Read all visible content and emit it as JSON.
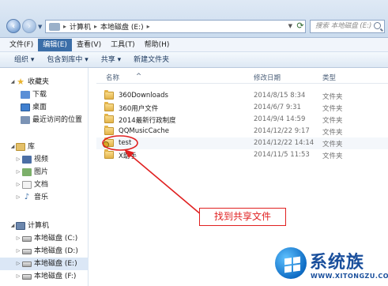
{
  "address_bar": {
    "segments": [
      "计算机",
      "本地磁盘 (E:)"
    ],
    "search_placeholder": "搜索 本地磁盘 (E:)"
  },
  "menu_bar": {
    "items": [
      {
        "label": "文件(F)",
        "active": false
      },
      {
        "label": "编辑(E)",
        "active": true
      },
      {
        "label": "查看(V)",
        "active": false
      },
      {
        "label": "工具(T)",
        "active": false
      },
      {
        "label": "帮助(H)",
        "active": false
      }
    ]
  },
  "toolbar": {
    "items": [
      "组织 ▾",
      "包含到库中 ▾",
      "共享 ▾",
      "新建文件夹"
    ]
  },
  "sidebar": {
    "favorites_label": "收藏夹",
    "favorites": [
      "下载",
      "桌面",
      "最近访问的位置"
    ],
    "libraries_label": "库",
    "libraries": [
      "视频",
      "图片",
      "文档",
      "音乐"
    ],
    "computer_label": "计算机",
    "drives": [
      "本地磁盘 (C:)",
      "本地磁盘 (D:)",
      "本地磁盘 (E:)",
      "本地磁盘 (F:)"
    ]
  },
  "file_list": {
    "columns": [
      "名称",
      "修改日期",
      "类型"
    ],
    "rows": [
      {
        "name": "360Downloads",
        "date": "2014/8/15 8:34",
        "type": "文件夹"
      },
      {
        "name": "360用户文件",
        "date": "2014/6/7 9:31",
        "type": "文件夹"
      },
      {
        "name": "2014最新行政制度",
        "date": "2014/9/4 14:59",
        "type": "文件夹"
      },
      {
        "name": "QQMusicCache",
        "date": "2014/12/22 9:17",
        "type": "文件夹"
      },
      {
        "name": "test",
        "date": "2014/12/22 14:14",
        "type": "文件夹"
      },
      {
        "name": "X助手",
        "date": "2014/11/5 11:53",
        "type": "文件夹"
      }
    ]
  },
  "annotation": {
    "callout_text": "找到共享文件",
    "color": "#e02020"
  },
  "watermark": {
    "title": "系统族",
    "url": "WWW.XITONGZU.COM"
  }
}
